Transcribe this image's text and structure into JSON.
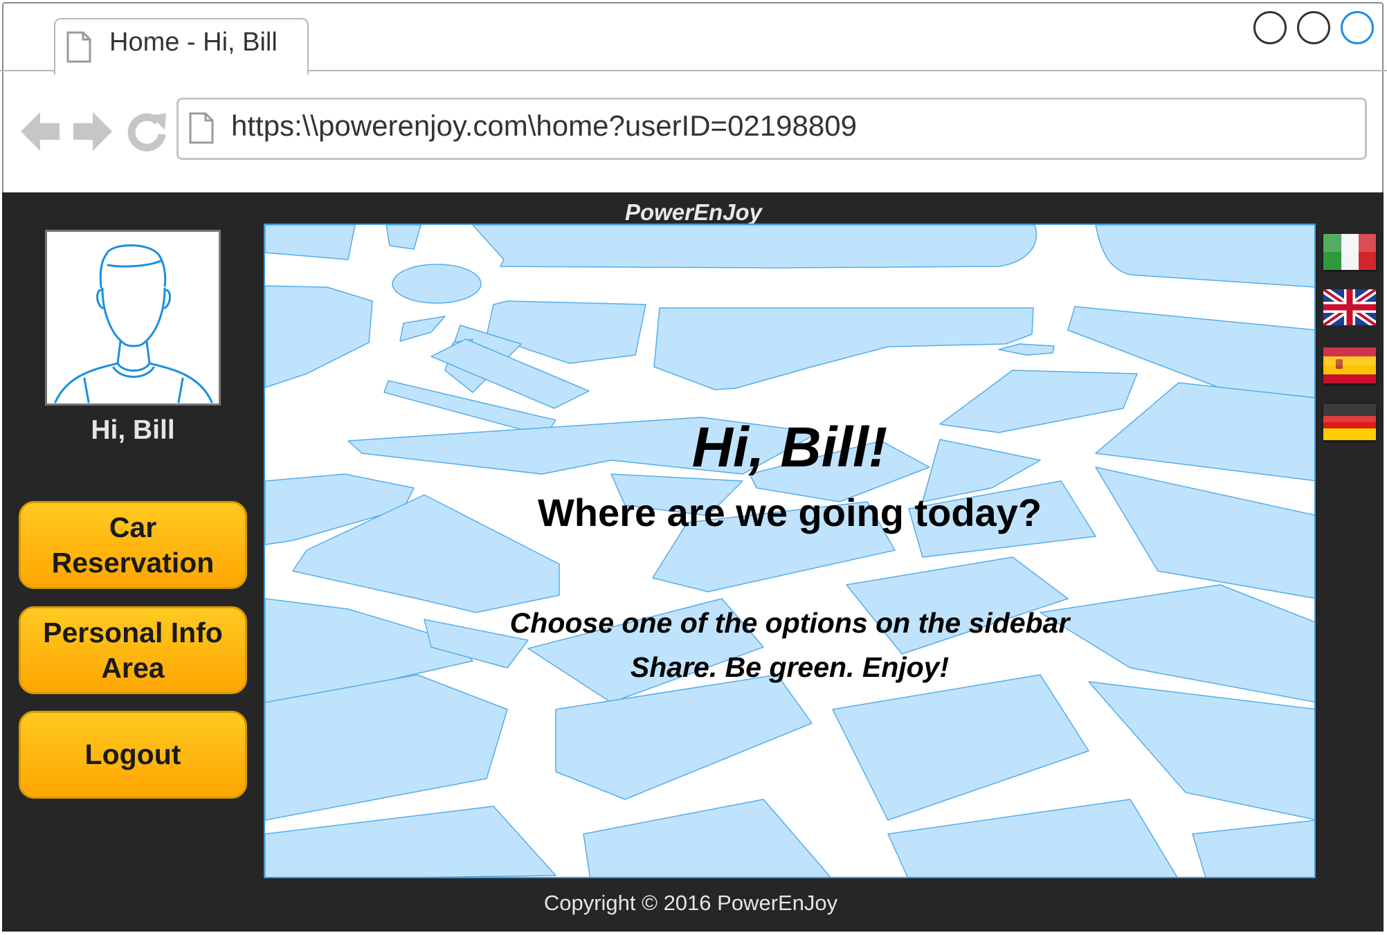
{
  "browser": {
    "tab_title": "Home - Hi, Bill",
    "url": "https:\\\\powerenjoy.com\\home?userID=02198809",
    "window_controls": [
      "circle-button",
      "circle-button",
      "circle-button"
    ]
  },
  "header": {
    "brand": "PowerEnJoy"
  },
  "sidebar": {
    "greeting": "Hi, Bill",
    "buttons": [
      {
        "label_line1": "Car",
        "label_line2": "Reservation"
      },
      {
        "label_line1": "Personal Info",
        "label_line2": "Area"
      },
      {
        "label_line1": "Logout",
        "label_line2": ""
      }
    ]
  },
  "main": {
    "headline": "Hi, Bill!",
    "subheadline": "Where are we going today?",
    "instruction": "Choose one of the options on the sidebar",
    "slogan": "Share. Be green. Enjoy!"
  },
  "languages": [
    "italian-flag",
    "uk-flag",
    "spanish-flag",
    "german-flag"
  ],
  "footer": {
    "copyright": "Copyright © 2016 PowerEnJoy"
  },
  "colors": {
    "app_background": "#262626",
    "button_gradient_top": "#ffca22",
    "button_gradient_bottom": "#ffa600",
    "map_block": "#bfe3fc",
    "map_outline": "#3f9ad6"
  }
}
